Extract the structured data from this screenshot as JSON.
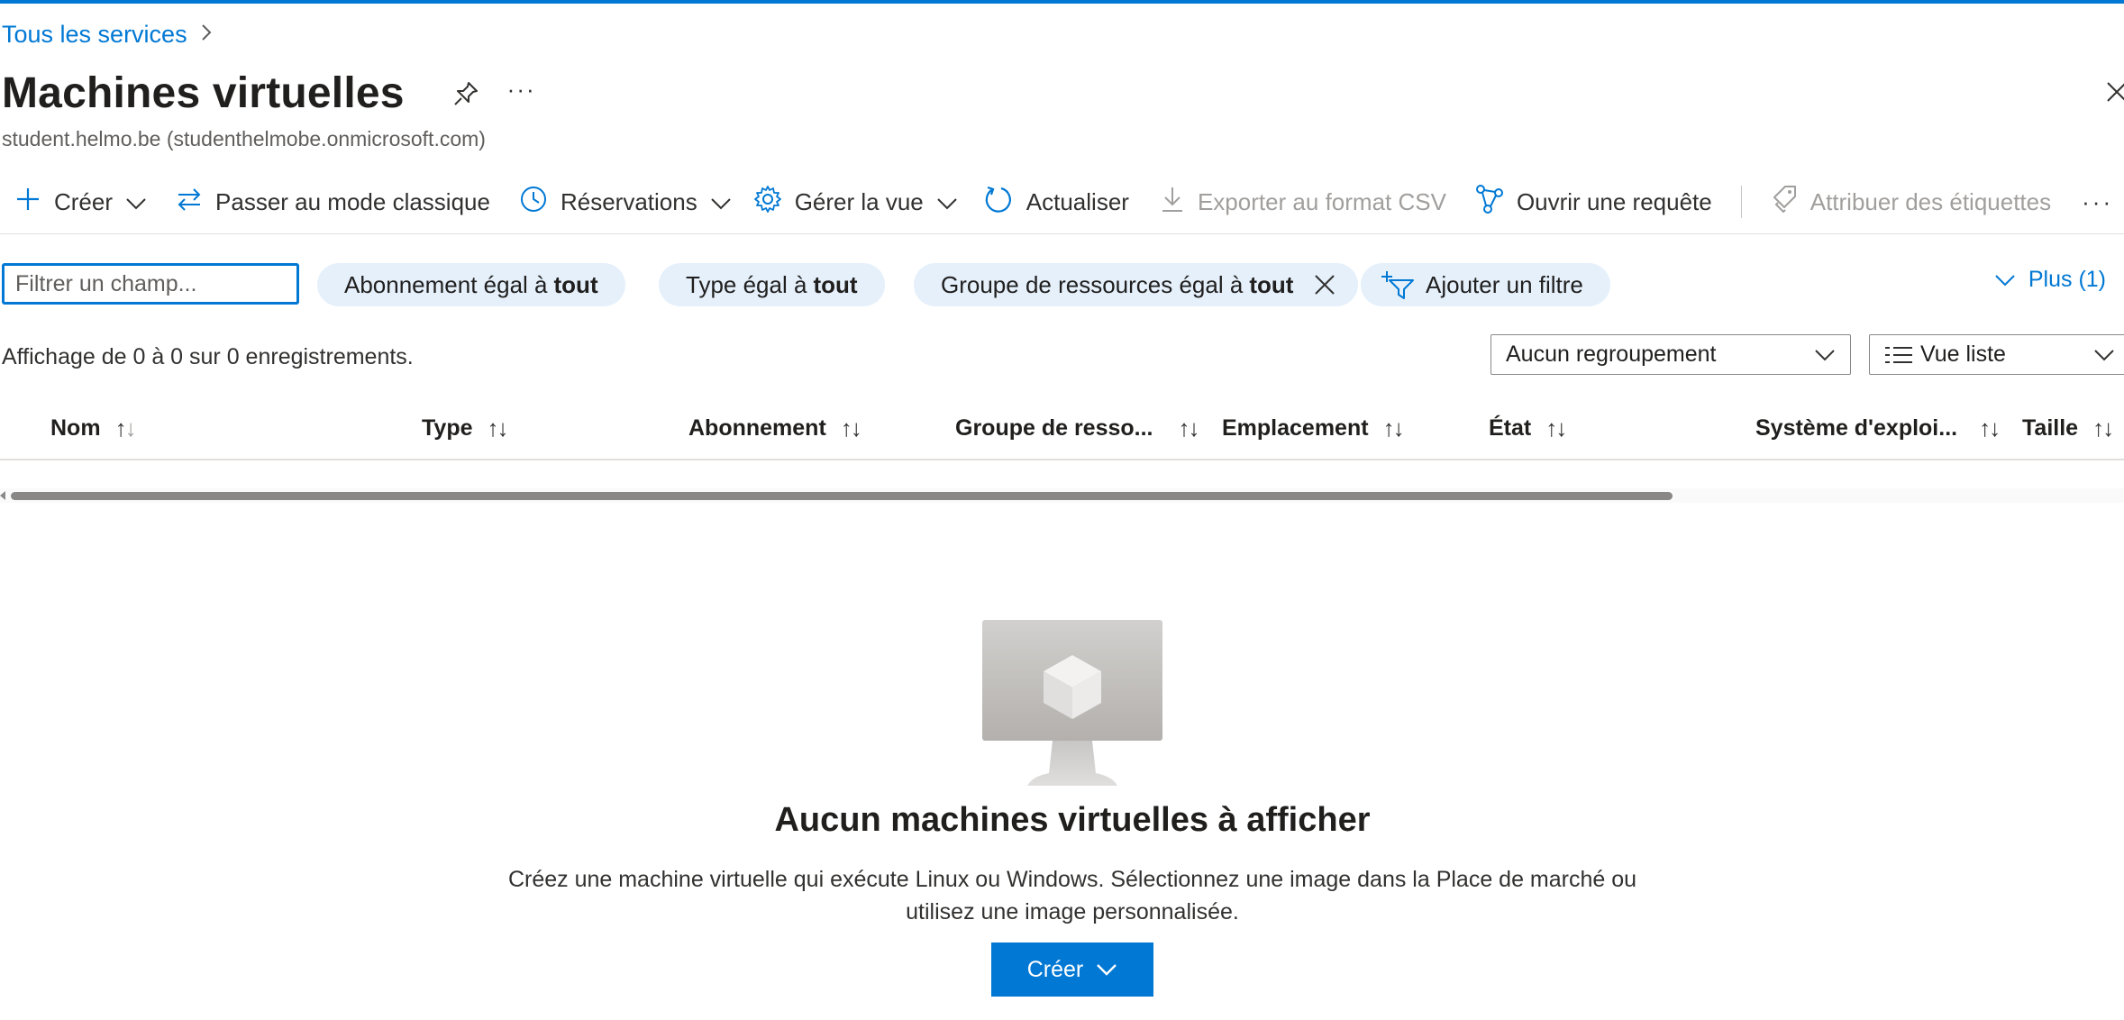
{
  "breadcrumb": {
    "link": "Tous les services"
  },
  "header": {
    "title": "Machines virtuelles",
    "subtitle": "student.helmo.be (studenthelmobe.onmicrosoft.com)",
    "more": "···"
  },
  "toolbar": {
    "create": "Créer",
    "switch_classic": "Passer au mode classique",
    "reservations": "Réservations",
    "manage_view": "Gérer la vue",
    "refresh": "Actualiser",
    "export_csv": "Exporter au format CSV",
    "open_query": "Ouvrir une requête",
    "assign_tags": "Attribuer des étiquettes",
    "more": "···"
  },
  "filters": {
    "search_placeholder": "Filtrer un champ...",
    "pills": [
      {
        "label": "Abonnement égal à",
        "value": "tout"
      },
      {
        "label": "Type égal à",
        "value": "tout"
      },
      {
        "label": "Groupe de ressources égal à",
        "value": "tout"
      }
    ],
    "add_filter": "Ajouter un filtre",
    "more_link": "Plus (1)"
  },
  "records_text": "Affichage de 0 à 0 sur 0 enregistrements.",
  "grouping": {
    "selected": "Aucun regroupement"
  },
  "view_mode": {
    "selected": "Vue liste"
  },
  "table": {
    "columns": [
      "Nom",
      "Type",
      "Abonnement",
      "Groupe de resso...",
      "Emplacement",
      "État",
      "Système d'exploi...",
      "Taille"
    ],
    "rows": []
  },
  "empty_state": {
    "title": "Aucun machines virtuelles à afficher",
    "line1": "Créez une machine virtuelle qui exécute Linux ou Windows. Sélectionnez une image dans la Place de marché ou",
    "line2": "utilisez une image personnalisée.",
    "button": "Créer"
  },
  "colors": {
    "accent": "#0078d4",
    "pill_bg": "#e5f0fb",
    "text": "#323130",
    "disabled": "#a19f9d"
  }
}
